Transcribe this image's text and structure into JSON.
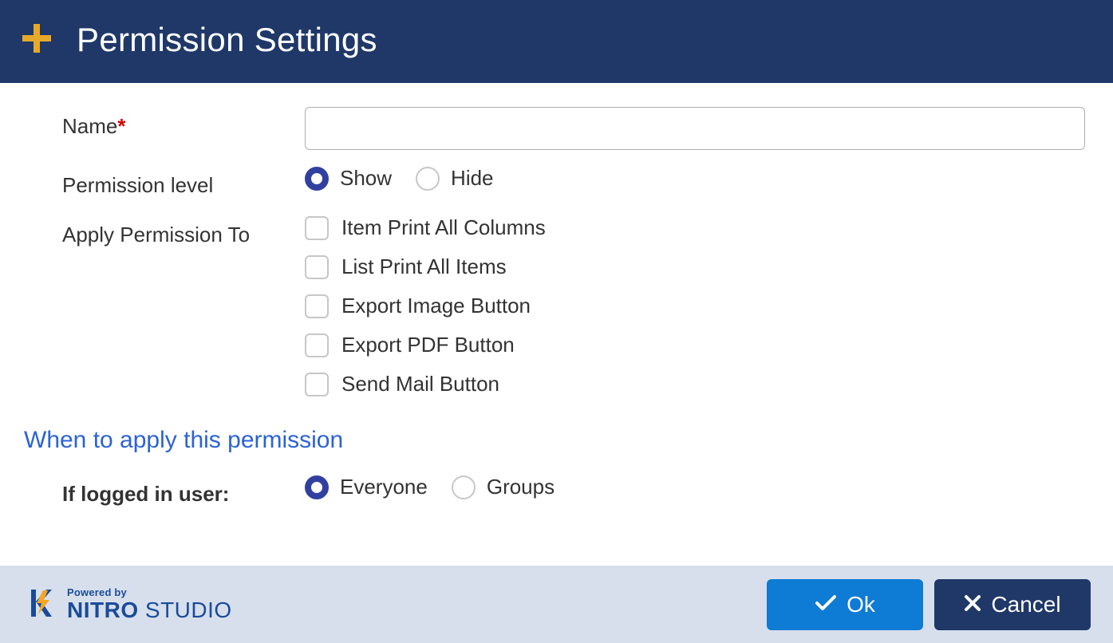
{
  "header": {
    "title": "Permission Settings"
  },
  "form": {
    "name_label": "Name",
    "name_value": "",
    "permission_level_label": "Permission level",
    "permission_level": {
      "options": [
        {
          "label": "Show",
          "selected": true
        },
        {
          "label": "Hide",
          "selected": false
        }
      ]
    },
    "apply_to_label": "Apply Permission To",
    "apply_to_options": [
      {
        "label": "Item Print All Columns",
        "checked": false
      },
      {
        "label": "List Print All Items",
        "checked": false
      },
      {
        "label": "Export Image Button",
        "checked": false
      },
      {
        "label": "Export PDF Button",
        "checked": false
      },
      {
        "label": "Send Mail Button",
        "checked": false
      }
    ]
  },
  "section": {
    "when_heading": "When to apply this permission",
    "if_logged_label": "If logged in user:",
    "user_scope": {
      "options": [
        {
          "label": "Everyone",
          "selected": true
        },
        {
          "label": "Groups",
          "selected": false
        }
      ]
    }
  },
  "footer": {
    "ok_label": "Ok",
    "cancel_label": "Cancel",
    "powered_by": "Powered by",
    "brand_bold": "NITRO",
    "brand_light": " STUDIO"
  }
}
